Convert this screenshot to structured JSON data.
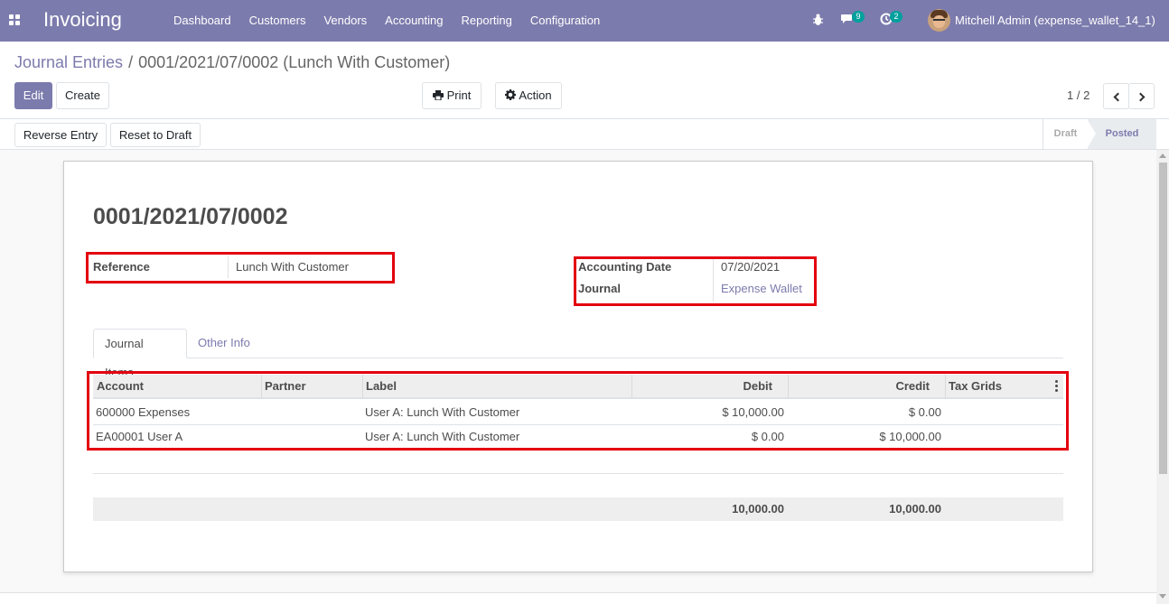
{
  "navbar": {
    "brand": "Invoicing",
    "menu": [
      "Dashboard",
      "Customers",
      "Vendors",
      "Accounting",
      "Reporting",
      "Configuration"
    ],
    "messages_count": "9",
    "activities_count": "2",
    "user_name": "Mitchell Admin (expense_wallet_14_1)",
    "color": "#7c7bad"
  },
  "breadcrumb": {
    "parent": "Journal Entries",
    "separator": "/",
    "current": "0001/2021/07/0002 (Lunch With Customer)"
  },
  "controls": {
    "edit_label": "Edit",
    "create_label": "Create",
    "print_label": "Print",
    "action_label": "Action",
    "pager_value": "1 / 2"
  },
  "statusbar": {
    "reverse_label": "Reverse Entry",
    "reset_label": "Reset to Draft",
    "stages": [
      "Draft",
      "Posted"
    ],
    "current_stage": "Posted"
  },
  "record": {
    "name": "0001/2021/07/0002",
    "reference_label": "Reference",
    "reference_value": "Lunch With Customer",
    "date_label": "Accounting Date",
    "date_value": "07/20/2021",
    "journal_label": "Journal",
    "journal_value": "Expense Wallet"
  },
  "tabs": [
    "Journal Items",
    "Other Info"
  ],
  "table": {
    "columns": [
      "Account",
      "Partner",
      "Label",
      "Debit",
      "Credit",
      "Tax Grids"
    ],
    "rows": [
      {
        "account": "600000 Expenses",
        "partner": "",
        "label": "User A: Lunch With Customer",
        "debit": "$ 10,000.00",
        "credit": "$ 0.00",
        "tax_grids": ""
      },
      {
        "account": "EA00001 User A",
        "partner": "",
        "label": "User A: Lunch With Customer",
        "debit": "$ 0.00",
        "credit": "$ 10,000.00",
        "tax_grids": ""
      }
    ],
    "total_debit": "10,000.00",
    "total_credit": "10,000.00"
  },
  "highlight_color": "#e3000f"
}
